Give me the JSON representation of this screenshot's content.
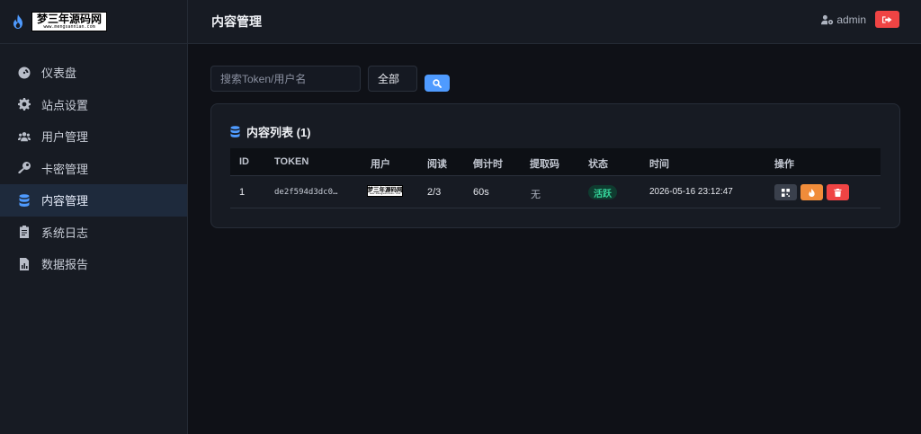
{
  "brand": {
    "logo_cn": "梦三年源码网",
    "logo_en": "www.mengsannian.com",
    "icon": "flame-icon"
  },
  "sidebar": {
    "items": [
      {
        "label": "仪表盘",
        "icon": "dashboard-icon"
      },
      {
        "label": "站点设置",
        "icon": "gear-icon"
      },
      {
        "label": "用户管理",
        "icon": "users-icon"
      },
      {
        "label": "卡密管理",
        "icon": "key-icon"
      },
      {
        "label": "内容管理",
        "icon": "database-icon",
        "active": true
      },
      {
        "label": "系统日志",
        "icon": "clipboard-icon"
      },
      {
        "label": "数据报告",
        "icon": "file-chart-icon"
      }
    ]
  },
  "header": {
    "title": "内容管理",
    "username": "admin"
  },
  "search": {
    "placeholder": "搜索Token/用户名",
    "filter_value": "全部"
  },
  "content_list": {
    "title": "内容列表 (1)",
    "columns": [
      "ID",
      "TOKEN",
      "用户",
      "阅读",
      "倒计时",
      "提取码",
      "状态",
      "时间",
      "操作"
    ],
    "rows": [
      {
        "id": "1",
        "token": "de2f594d3dc0…",
        "user_logo_cn": "梦三年源码网",
        "user_logo_en": "www.mengsannian.com",
        "reads": "2/3",
        "countdown": "60s",
        "code": "无",
        "status": "活跃",
        "time": "2026-05-16 23:12:47"
      }
    ]
  },
  "colors": {
    "accent": "#4f9bff",
    "danger": "#ef4444",
    "warning": "#f08c3a",
    "success": "#35d49a"
  }
}
